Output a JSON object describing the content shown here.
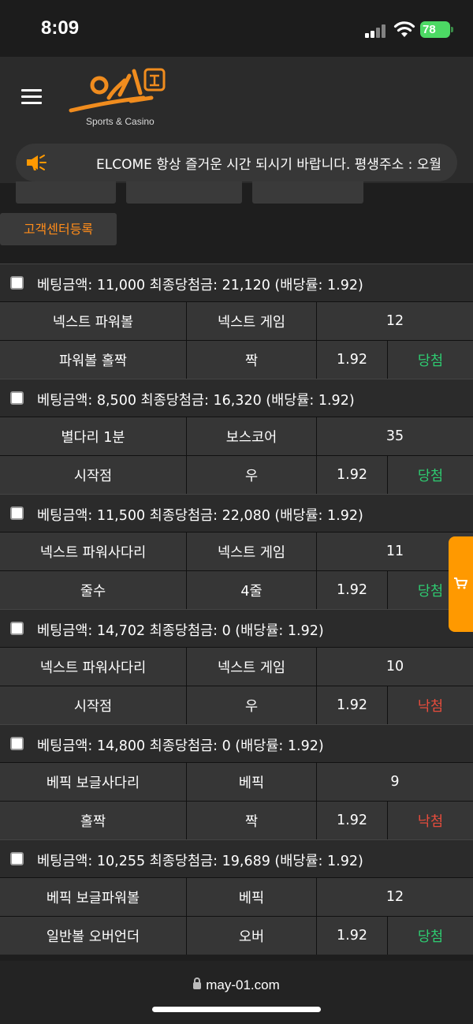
{
  "status_bar": {
    "time": "8:09",
    "battery": "78"
  },
  "header": {
    "logo_sub": "Sports & Casino"
  },
  "notice": {
    "text": "ELCOME 항상 즐거운 시간 되시기 바랍니다. 평생주소 : 오월"
  },
  "buttons": {
    "customer_center": "고객센터등록"
  },
  "bets": [
    {
      "summary": "베팅금액: 11,000 최종당첨금: 21,120 (배당률: 1.92)",
      "game": "넥스트 파워볼",
      "type": "넥스트 게임",
      "round": "12",
      "market": "파워볼 홀짝",
      "pick": "짝",
      "odds": "1.92",
      "result": "당첨",
      "win": true
    },
    {
      "summary": "베팅금액: 8,500 최종당첨금: 16,320 (배당률: 1.92)",
      "game": "별다리 1분",
      "type": "보스코어",
      "round": "35",
      "market": "시작점",
      "pick": "우",
      "odds": "1.92",
      "result": "당첨",
      "win": true
    },
    {
      "summary": "베팅금액: 11,500 최종당첨금: 22,080 (배당률: 1.92)",
      "game": "넥스트 파워사다리",
      "type": "넥스트 게임",
      "round": "11",
      "market": "줄수",
      "pick": "4줄",
      "odds": "1.92",
      "result": "당첨",
      "win": true
    },
    {
      "summary": "베팅금액: 14,702 최종당첨금: 0 (배당률: 1.92)",
      "game": "넥스트 파워사다리",
      "type": "넥스트 게임",
      "round": "10",
      "market": "시작점",
      "pick": "우",
      "odds": "1.92",
      "result": "낙첨",
      "win": false
    },
    {
      "summary": "베팅금액: 14,800 최종당첨금: 0 (배당률: 1.92)",
      "game": "베픽 보글사다리",
      "type": "베픽",
      "round": "9",
      "market": "홀짝",
      "pick": "짝",
      "odds": "1.92",
      "result": "낙첨",
      "win": false
    },
    {
      "summary": "베팅금액: 10,255 최종당첨금: 19,689 (배당률: 1.92)",
      "game": "베픽 보글파워볼",
      "type": "베픽",
      "round": "12",
      "market": "일반볼 오버언더",
      "pick": "오버",
      "odds": "1.92",
      "result": "당첨",
      "win": true
    }
  ],
  "browser": {
    "url": "may-01.com"
  },
  "colors": {
    "accent": "#ff8c1a",
    "win": "#2ecc71",
    "lose": "#e74c3c",
    "cart": "#ff9900"
  },
  "icons": [
    "hamburger-icon",
    "megaphone-icon",
    "cart-icon",
    "lock-icon",
    "wifi-icon",
    "signal-icon"
  ]
}
